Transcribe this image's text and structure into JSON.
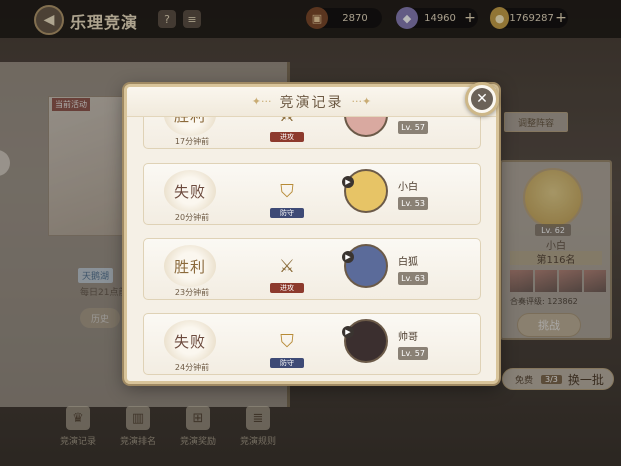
{
  "header": {
    "title": "乐理竞演",
    "help_icon": "?",
    "info_icon": "≡"
  },
  "resources": [
    {
      "name": "book",
      "icon": "book-icon",
      "value": "2870"
    },
    {
      "name": "gem",
      "icon": "gem-icon",
      "value": "14960"
    },
    {
      "name": "gold",
      "icon": "coin-icon",
      "value": "1769287"
    }
  ],
  "right_panel": {
    "adjust_label": "调整阵容",
    "lv": "Lv. 62",
    "name": "小白",
    "rank": "第116名",
    "power": "合奏评级: 123862",
    "challenge_label": "挑战",
    "refresh_free": "免费",
    "refresh_count": "3/3",
    "refresh_label": "换一批"
  },
  "left_panel": {
    "tag": "当前活动",
    "news": "天鹅湖",
    "note": "每日21点前提",
    "button": "历史"
  },
  "bottom_nav": [
    {
      "label": "竞演记录",
      "icon": "trophy-icon"
    },
    {
      "label": "竞演排名",
      "icon": "chart-icon"
    },
    {
      "label": "竞演奖励",
      "icon": "gift-icon"
    },
    {
      "label": "竞演规则",
      "icon": "document-icon"
    }
  ],
  "modal": {
    "title": "竞演记录",
    "records": [
      {
        "result": "胜利",
        "result_type": "win",
        "time": "17分钟前",
        "mode": "进攻",
        "mode_type": "attack",
        "opponent": "",
        "lv": "Lv. 57",
        "avatar_color": "#d9a9a0"
      },
      {
        "result": "失败",
        "result_type": "loss",
        "time": "20分钟前",
        "mode": "防守",
        "mode_type": "defend",
        "opponent": "小白",
        "lv": "Lv. 53",
        "avatar_color": "#e7c466"
      },
      {
        "result": "胜利",
        "result_type": "win",
        "time": "23分钟前",
        "mode": "进攻",
        "mode_type": "attack",
        "opponent": "白狐",
        "lv": "Lv. 63",
        "avatar_color": "#5b6b9a"
      },
      {
        "result": "失败",
        "result_type": "loss",
        "time": "24分钟前",
        "mode": "防守",
        "mode_type": "defend",
        "opponent": "帅哥",
        "lv": "Lv. 57",
        "avatar_color": "#3b2f2f"
      }
    ]
  }
}
